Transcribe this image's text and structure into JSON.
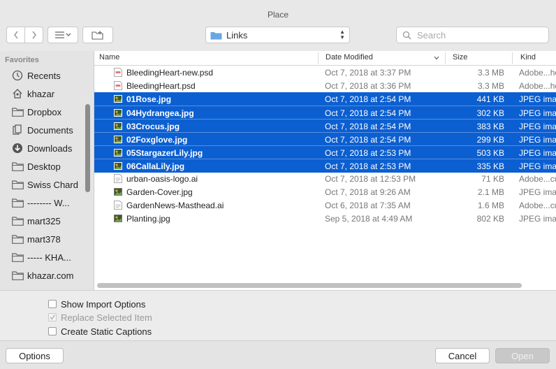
{
  "window": {
    "title": "Place"
  },
  "toolbar": {
    "location": "Links",
    "search_placeholder": "Search"
  },
  "sidebar": {
    "section": "Favorites",
    "items": [
      {
        "label": "Recents",
        "icon": "clock-icon"
      },
      {
        "label": "khazar",
        "icon": "home-icon"
      },
      {
        "label": "Dropbox",
        "icon": "folder-icon"
      },
      {
        "label": "Documents",
        "icon": "document-icon"
      },
      {
        "label": "Downloads",
        "icon": "download-icon"
      },
      {
        "label": "Desktop",
        "icon": "folder-icon"
      },
      {
        "label": "Swiss Chard",
        "icon": "folder-icon"
      },
      {
        "label": "-------- W...",
        "icon": "folder-icon"
      },
      {
        "label": "mart325",
        "icon": "folder-icon"
      },
      {
        "label": "mart378",
        "icon": "folder-icon"
      },
      {
        "label": "----- KHA...",
        "icon": "folder-icon"
      },
      {
        "label": "khazar.com",
        "icon": "folder-icon"
      }
    ]
  },
  "columns": {
    "name": "Name",
    "date": "Date Modified",
    "size": "Size",
    "kind": "Kind"
  },
  "files": [
    {
      "name": "BleedingHeart-new.psd",
      "date": "Oct 7, 2018 at 3:37 PM",
      "size": "3.3 MB",
      "kind": "Adobe...hop",
      "selected": false,
      "icon": "psd-file-icon"
    },
    {
      "name": "BleedingHeart.psd",
      "date": "Oct 7, 2018 at 3:36 PM",
      "size": "3.3 MB",
      "kind": "Adobe...hop",
      "selected": false,
      "icon": "psd-file-icon"
    },
    {
      "name": "01Rose.jpg",
      "date": "Oct 7, 2018 at 2:54 PM",
      "size": "441 KB",
      "kind": "JPEG image",
      "selected": true,
      "icon": "image-file-icon"
    },
    {
      "name": "04Hydrangea.jpg",
      "date": "Oct 7, 2018 at 2:54 PM",
      "size": "302 KB",
      "kind": "JPEG image",
      "selected": true,
      "icon": "image-file-icon"
    },
    {
      "name": "03Crocus.jpg",
      "date": "Oct 7, 2018 at 2:54 PM",
      "size": "383 KB",
      "kind": "JPEG image",
      "selected": true,
      "icon": "image-file-icon"
    },
    {
      "name": "02Foxglove.jpg",
      "date": "Oct 7, 2018 at 2:54 PM",
      "size": "299 KB",
      "kind": "JPEG image",
      "selected": true,
      "icon": "image-file-icon"
    },
    {
      "name": "05StargazerLily.jpg",
      "date": "Oct 7, 2018 at 2:53 PM",
      "size": "503 KB",
      "kind": "JPEG image",
      "selected": true,
      "icon": "image-file-icon"
    },
    {
      "name": "06CallaLily.jpg",
      "date": "Oct 7, 2018 at 2:53 PM",
      "size": "335 KB",
      "kind": "JPEG image",
      "selected": true,
      "icon": "image-file-icon"
    },
    {
      "name": "urban-oasis-logo.ai",
      "date": "Oct 7, 2018 at 12:53 PM",
      "size": "71 KB",
      "kind": "Adobe...cument",
      "selected": false,
      "icon": "ai-file-icon"
    },
    {
      "name": "Garden-Cover.jpg",
      "date": "Oct 7, 2018 at 9:26 AM",
      "size": "2.1 MB",
      "kind": "JPEG image",
      "selected": false,
      "icon": "image-file-icon"
    },
    {
      "name": "GardenNews-Masthead.ai",
      "date": "Oct 6, 2018 at 7:35 AM",
      "size": "1.6 MB",
      "kind": "Adobe...cument",
      "selected": false,
      "icon": "ai-file-icon"
    },
    {
      "name": "Planting.jpg",
      "date": "Sep 5, 2018 at 4:49 AM",
      "size": "802 KB",
      "kind": "JPEG image",
      "selected": false,
      "icon": "image-file-icon"
    }
  ],
  "options": {
    "show_import": {
      "label": "Show Import Options",
      "checked": false,
      "enabled": true
    },
    "replace_selected": {
      "label": "Replace Selected Item",
      "checked": true,
      "enabled": false
    },
    "static_captions": {
      "label": "Create Static Captions",
      "checked": false,
      "enabled": true
    }
  },
  "buttons": {
    "options": "Options",
    "cancel": "Cancel",
    "open": "Open"
  },
  "colors": {
    "selection": "#0c5fd0",
    "folder": "#6aa6e6"
  }
}
